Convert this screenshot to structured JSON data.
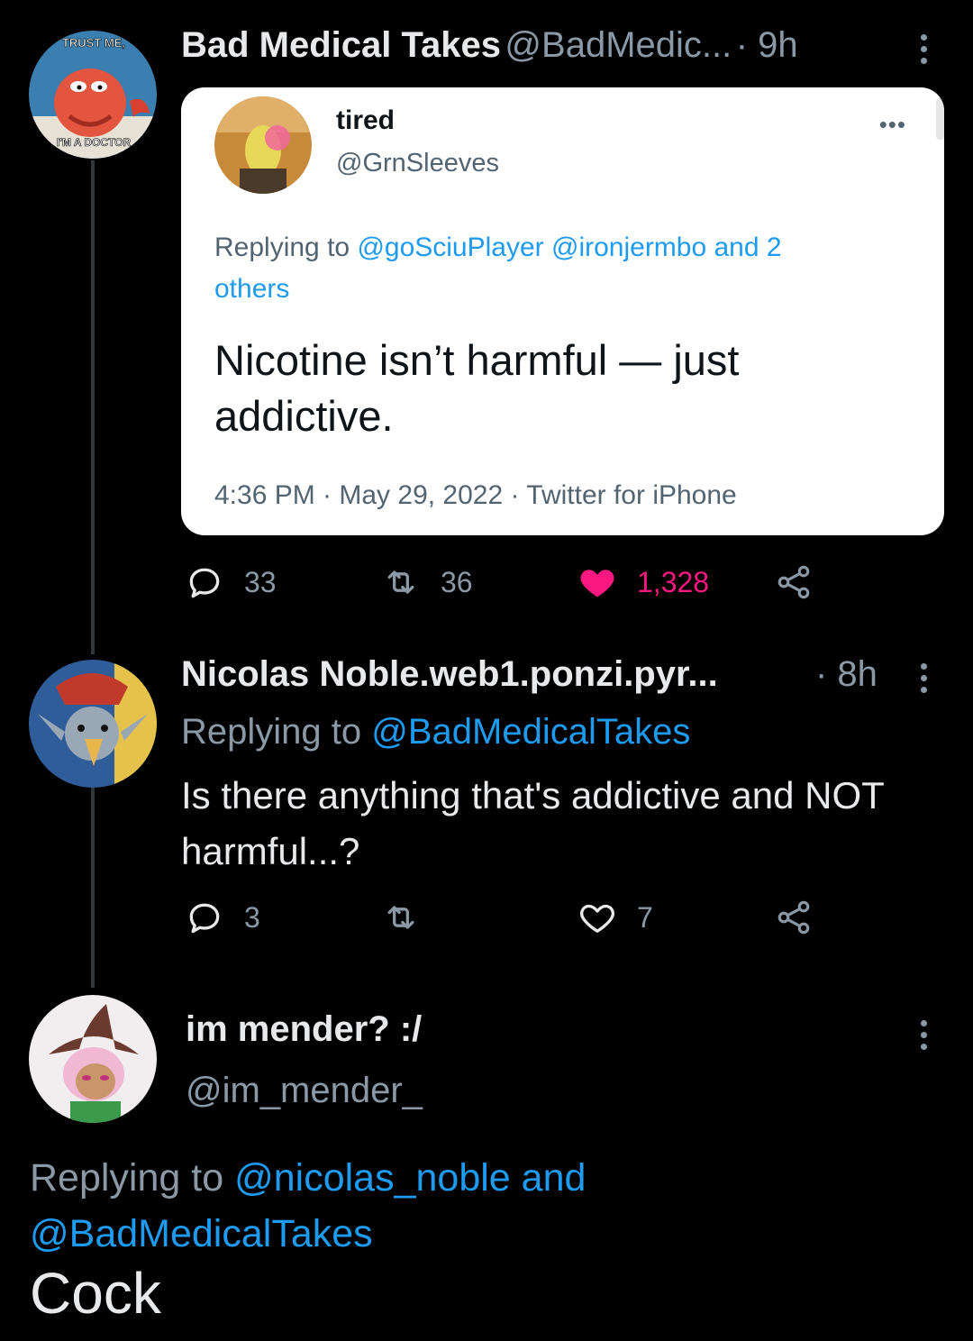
{
  "tweet1": {
    "name": "Bad Medical Takes",
    "handle": "@BadMedic...",
    "time": "· 9h",
    "avatar_text_top": "TRUST ME,",
    "avatar_text_bottom": "I'M A DOCTOR",
    "quote": {
      "name": "tired",
      "handle": "@GrnSleeves",
      "more": "•••",
      "reply_prefix": "Replying to ",
      "reply_mentions": "@goSciuPlayer @ironjermbo and 2 others",
      "text": "Nicotine isn’t harmful — just addictive.",
      "meta": "4:36 PM · May 29, 2022 · Twitter for iPhone"
    },
    "actions": {
      "replies": "33",
      "retweets": "36",
      "likes": "1,328",
      "liked": true
    }
  },
  "tweet2": {
    "name": "Nicolas Noble.web1.ponzi.pyr...",
    "time": "· 8h",
    "reply_prefix": "Replying to ",
    "reply_mention": "@BadMedicalTakes",
    "text": "Is there anything that's addictive and NOT harmful...?",
    "actions": {
      "replies": "3",
      "retweets": "",
      "likes": "7",
      "liked": false
    }
  },
  "tweet3": {
    "name": "im mender? :/",
    "handle": "@im_mender_",
    "reply_prefix": "Replying to ",
    "reply_mentions": "@nicolas_noble and @BadMedicalTakes",
    "text": "Cock"
  },
  "colors": {
    "background": "#000000",
    "link": "#1d9bf0",
    "like": "#f91880",
    "muted": "#8b98a5"
  }
}
